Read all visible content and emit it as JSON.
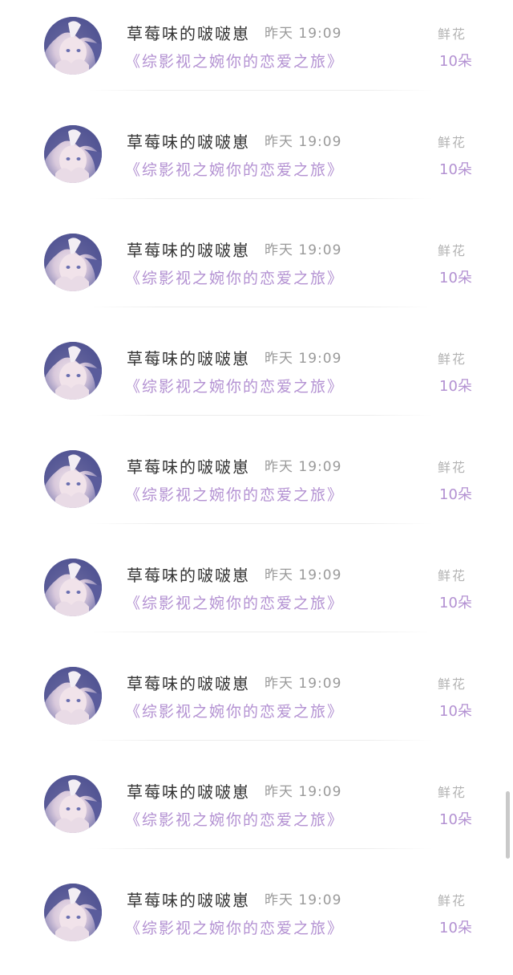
{
  "items": [
    {
      "name": "草莓味的啵啵崽",
      "time": "昨天 19:09",
      "title": "《综影视之婉你的恋爱之旅》",
      "gift_label": "鲜花",
      "gift_count": "10朵"
    },
    {
      "name": "草莓味的啵啵崽",
      "time": "昨天 19:09",
      "title": "《综影视之婉你的恋爱之旅》",
      "gift_label": "鲜花",
      "gift_count": "10朵"
    },
    {
      "name": "草莓味的啵啵崽",
      "time": "昨天 19:09",
      "title": "《综影视之婉你的恋爱之旅》",
      "gift_label": "鲜花",
      "gift_count": "10朵"
    },
    {
      "name": "草莓味的啵啵崽",
      "time": "昨天 19:09",
      "title": "《综影视之婉你的恋爱之旅》",
      "gift_label": "鲜花",
      "gift_count": "10朵"
    },
    {
      "name": "草莓味的啵啵崽",
      "time": "昨天 19:09",
      "title": "《综影视之婉你的恋爱之旅》",
      "gift_label": "鲜花",
      "gift_count": "10朵"
    },
    {
      "name": "草莓味的啵啵崽",
      "time": "昨天 19:09",
      "title": "《综影视之婉你的恋爱之旅》",
      "gift_label": "鲜花",
      "gift_count": "10朵"
    },
    {
      "name": "草莓味的啵啵崽",
      "time": "昨天 19:09",
      "title": "《综影视之婉你的恋爱之旅》",
      "gift_label": "鲜花",
      "gift_count": "10朵"
    },
    {
      "name": "草莓味的啵啵崽",
      "time": "昨天 19:09",
      "title": "《综影视之婉你的恋爱之旅》",
      "gift_label": "鲜花",
      "gift_count": "10朵"
    },
    {
      "name": "草莓味的啵啵崽",
      "time": "昨天 19:09",
      "title": "《综影视之婉你的恋爱之旅》",
      "gift_label": "鲜花",
      "gift_count": "10朵"
    }
  ],
  "colors": {
    "title_accent": "#b391d2",
    "name_text": "#333333",
    "muted_text": "#9a9a9a"
  },
  "icons": {
    "avatar": "anime-girl-avatar"
  }
}
